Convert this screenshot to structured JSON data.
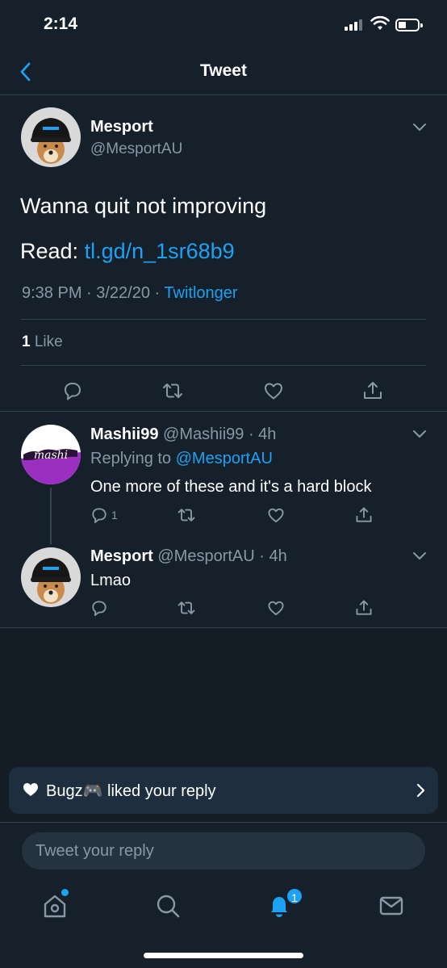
{
  "status_bar": {
    "time": "2:14"
  },
  "nav": {
    "title": "Tweet"
  },
  "main_tweet": {
    "author_name": "Mesport",
    "author_handle": "@MesportAU",
    "text": "Wanna quit not improving",
    "read_label": "Read: ",
    "read_link": "tl.gd/n_1sr68b9",
    "time": "9:38 PM · 3/22/20 · ",
    "source": "Twitlonger",
    "like_count": "1",
    "like_label": " Like"
  },
  "replies": [
    {
      "name": "Mashii99",
      "handle_time": " @Mashii99 · 4h",
      "replying_label": "Replying to ",
      "replying_to": "@MesportAU",
      "text": "One more of these and it's a hard block",
      "reply_count": "1"
    },
    {
      "name": "Mesport",
      "handle_time": " @MesportAU · 4h",
      "text": "Lmao"
    }
  ],
  "toast": {
    "text": "Bugz🎮 liked your reply"
  },
  "reply_box": {
    "placeholder": "Tweet your reply"
  },
  "tab_bar": {
    "notifications_badge": "1"
  },
  "colors": {
    "background": "#15202b",
    "accent": "#1da1f2",
    "secondary_text": "#8899a6",
    "border": "#38444d"
  },
  "icons": [
    "back-icon",
    "chevron-down-icon",
    "reply-icon",
    "retweet-icon",
    "like-icon",
    "share-icon",
    "heart-icon",
    "chevron-right-icon",
    "home-icon",
    "search-icon",
    "bell-icon",
    "mail-icon"
  ]
}
